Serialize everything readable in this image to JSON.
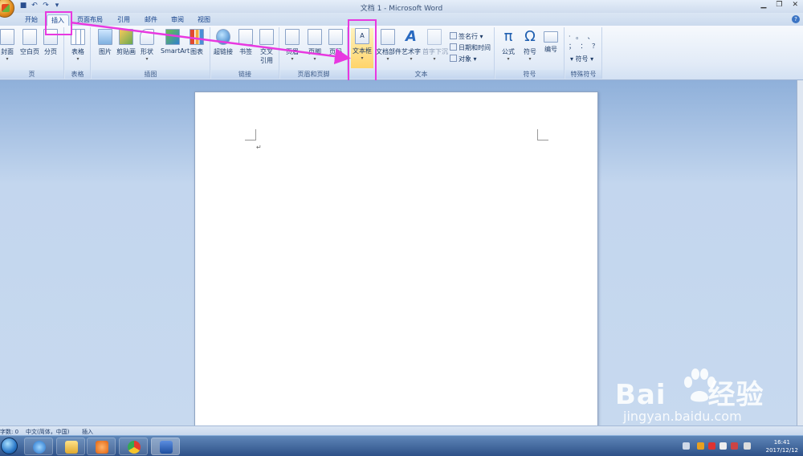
{
  "window": {
    "title": "文档 1 - Microsoft Word",
    "controls": [
      "▁",
      "❐",
      "✕"
    ]
  },
  "tabs": [
    {
      "label": "开始"
    },
    {
      "label": "插入"
    },
    {
      "label": "页面布局"
    },
    {
      "label": "引用"
    },
    {
      "label": "邮件"
    },
    {
      "label": "审阅"
    },
    {
      "label": "视图"
    }
  ],
  "ribbon": {
    "groups": {
      "pages": {
        "label": "页",
        "buttons": [
          "封面",
          "空白页",
          "分页"
        ]
      },
      "tables": {
        "label": "表格",
        "buttons": [
          "表格"
        ]
      },
      "illustrations": {
        "label": "插图",
        "buttons": [
          "图片",
          "剪贴画",
          "形状",
          "SmartArt",
          "图表"
        ]
      },
      "links": {
        "label": "链接",
        "buttons": [
          "超链接",
          "书签",
          "交叉",
          "引用"
        ]
      },
      "header_footer": {
        "label": "页眉和页脚",
        "buttons": [
          "页眉",
          "页脚",
          "页码"
        ]
      },
      "text": {
        "label": "文本",
        "buttons": [
          "文本框",
          "文档部件",
          "艺术字",
          "首字下沉"
        ],
        "small": [
          "签名行",
          "日期和时间",
          "对象"
        ]
      },
      "symbols": {
        "label": "符号",
        "buttons": [
          "公式",
          "符号",
          "编号"
        ]
      },
      "special": {
        "label": "特殊符号",
        "symbols": "· 。 、 ； ： ？",
        "button": "符号"
      }
    }
  },
  "statusbar": {
    "words": "字数: 0",
    "language": "中文(简体，中国)",
    "mode": "插入"
  },
  "taskbar": {
    "clock_time": "16:41",
    "clock_date": "2017/12/12"
  },
  "watermark": {
    "logo": "Bai",
    "logo_suffix": "经验",
    "url": "jingyan.baidu.com"
  },
  "colors": {
    "highlight": "#e838e0",
    "accent": "#15428b"
  }
}
